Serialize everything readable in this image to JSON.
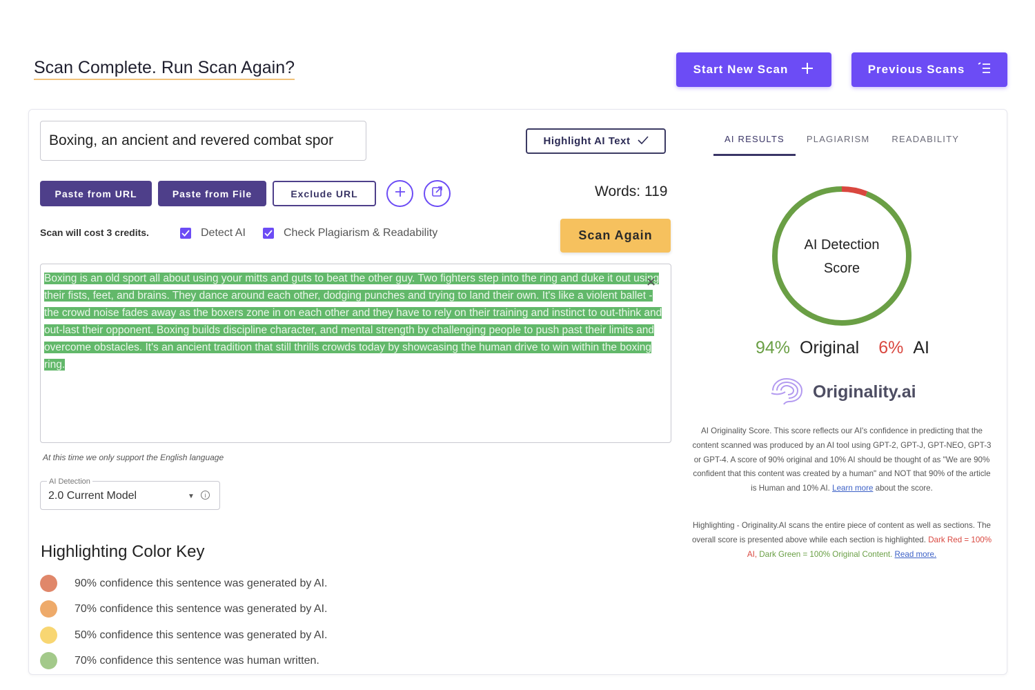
{
  "header": {
    "title": "Scan Complete. Run Scan Again?",
    "start_new_scan": "Start New Scan",
    "previous_scans": "Previous Scans"
  },
  "form": {
    "title_value": "Boxing, an ancient and revered combat spor",
    "highlight_ai_text": "Highlight AI Text",
    "paste_from_url": "Paste from URL",
    "paste_from_file": "Paste from File",
    "exclude_url": "Exclude URL",
    "words_label": "Words: 119",
    "cost_note": "Scan will cost 3 credits.",
    "detect_ai_label": "Detect AI",
    "check_plag_label": "Check Plagiarism & Readability",
    "scan_again": "Scan Again",
    "content_text": "Boxing is an old sport all about using your mitts and guts to beat the other guy.  Two fighters step into the ring and duke it out using their fists, feet, and brains.  They dance around each other, dodging punches and trying to land their own.  It's like a violent ballet - the crowd noise fades away as the boxers zone in on each other and they have to rely on their training and instinct to out-think and out-last their opponent.  Boxing builds discipline character, and mental strength by challenging people to push past their limits and overcome obstacles.  It's an ancient tradition that still thrills crowds today by showcasing the human drive to win within the boxing ring.",
    "language_note": "At this time we only support the English language",
    "model_legend": "AI Detection",
    "model_value": "2.0 Current Model"
  },
  "color_key": {
    "title": "Highlighting Color Key",
    "items": [
      {
        "label": "90% confidence this sentence was generated by AI.",
        "color": "#e0876a"
      },
      {
        "label": "70% confidence this sentence was generated by AI.",
        "color": "#eeaa6a"
      },
      {
        "label": "50% confidence this sentence was generated by AI.",
        "color": "#f8d672"
      },
      {
        "label": "70% confidence this sentence was human written.",
        "color": "#a3c98a"
      }
    ]
  },
  "results": {
    "tabs": [
      "AI RESULTS",
      "PLAGIARISM",
      "READABILITY"
    ],
    "gauge_label_line1": "AI Detection",
    "gauge_label_line2": "Score",
    "original_pct": "94%",
    "original_label": "Original",
    "ai_pct": "6%",
    "ai_label": "AI",
    "original_fraction": 0.94,
    "ai_fraction": 0.06,
    "brand": "Originality.ai",
    "desc_text": "AI Originality Score. This score reflects our AI's confidence in predicting that the content scanned was produced by an AI tool using GPT-2, GPT-J, GPT-NEO, GPT-3 or GPT-4. A score of 90% original and 10% AI should be thought of as \"We are 90% confident that this content was created by a human\" and NOT that 90% of the article is Human and 10% AI.",
    "learn_more": "Learn more",
    "desc_tail": "about the score.",
    "highlight_text": "Highlighting - Originality.AI scans the entire piece of content as well as sections. The overall score is presented above while each section is highlighted.",
    "dark_red": "Dark Red = 100% AI,",
    "dark_green": "Dark Green = 100% Original Content.",
    "read_more": "Read more."
  },
  "colors": {
    "accent": "#6c4cf5",
    "dark_button": "#4e3f8a",
    "scan_again": "#f6c15e",
    "original_green": "#6a9f45",
    "ai_red": "#d9473f",
    "highlight_green": "#62b86a"
  }
}
